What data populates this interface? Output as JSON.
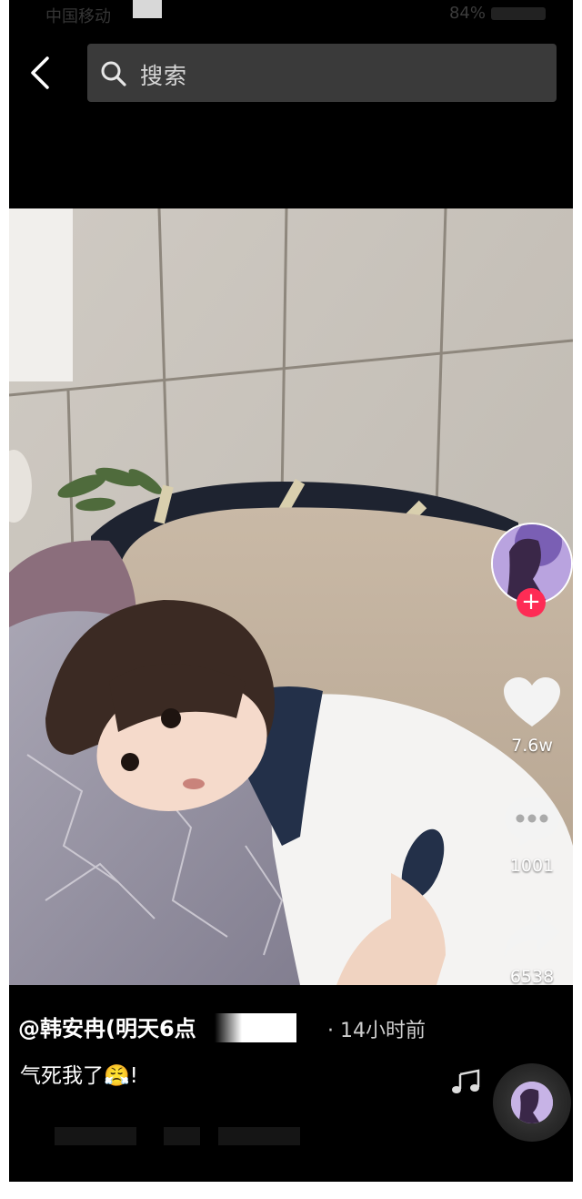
{
  "status_bar": {
    "left_text": "中国移动",
    "battery": "84%"
  },
  "search": {
    "placeholder": "搜索"
  },
  "video": {
    "author": "@韩安冉(明天6点",
    "time_ago": "· 14小时前",
    "caption": "气死我了😤!",
    "likes": "7.6w",
    "comments": "1001",
    "shares": "6538",
    "follow_symbol": "+"
  },
  "colors": {
    "background": "#000000",
    "accent_follow": "#fe2c55",
    "search_box": "#3a3a3a"
  }
}
